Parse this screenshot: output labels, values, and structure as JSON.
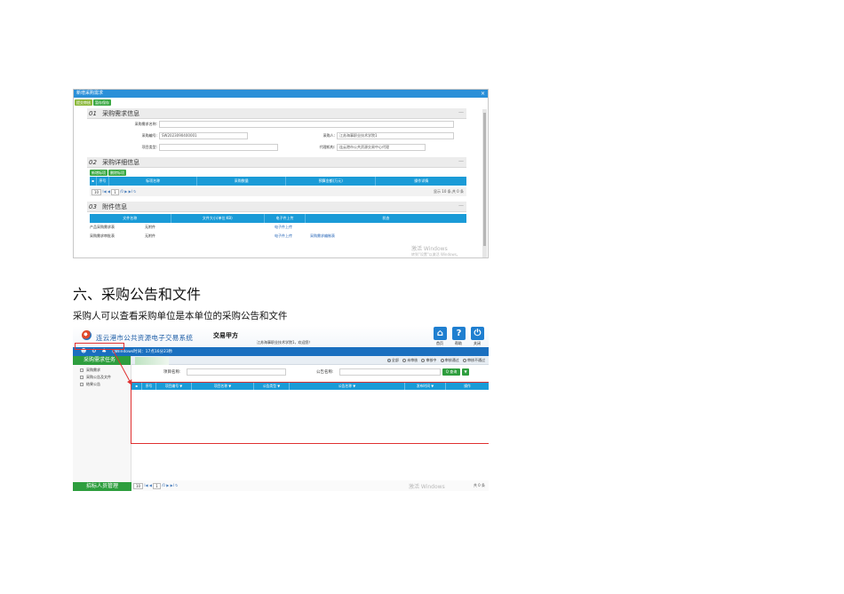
{
  "screenshot1": {
    "window_title": "新增采购需求",
    "toolbar": {
      "submit_label": "提交审核",
      "save_label": "暂存保存"
    },
    "section1": {
      "num": "01",
      "title": "采购需求信息"
    },
    "form": {
      "demand_name_label": "采购需求名称:",
      "demand_code_label": "采购编号:",
      "demand_code_value": "SW2023090400001",
      "purchaser_label": "采购人:",
      "purchaser_value": "江苏海事职业技术学院1",
      "project_type_label": "项目类型:",
      "agency_label": "代理机构:",
      "agency_value": "连云港市公共资源交易中心代理"
    },
    "section2": {
      "num": "02",
      "title": "采购详细信息"
    },
    "grid_tools": {
      "add_label": "新增标项",
      "delete_label": "删除标项"
    },
    "grid_columns": [
      "序号",
      "标项名称",
      "采购数量",
      "预算金额(万元)",
      "操作详情"
    ],
    "pager1": {
      "page_size": "10",
      "page": "1",
      "of": "/0",
      "info": "显示 10 条,共 0 条"
    },
    "section3": {
      "num": "03",
      "title": "附件信息"
    },
    "att_columns": [
      "文件名称",
      "文件大小(单位:KB)",
      "电子件上传",
      "状态"
    ],
    "att_rows": [
      {
        "name": "产品采购需求表",
        "size": "无附件",
        "upload": "电子件上传",
        "status": ""
      },
      {
        "name": "采购需求审批表",
        "size": "无附件",
        "upload": "电子件上传",
        "status": "采购需求编制表"
      }
    ],
    "watermark_title": "激活 Windows",
    "watermark_sub": "转到\"设置\"以激活 Windows。",
    "more_glyph": "—",
    "close_glyph": "×"
  },
  "heading": "六、采购公告和文件",
  "paragraph": "采购人可以查看采购单位是本单位的采购公告和文件",
  "screenshot2": {
    "system_title": "连云港市公共资源电子交易系统",
    "role_title": "交易甲方",
    "welcome": "江苏海事职业技术学院1，欢迎您！",
    "header_buttons": [
      {
        "label": "首页",
        "glyph": "⌂"
      },
      {
        "label": "帮助",
        "glyph": "?"
      },
      {
        "label": "关闭",
        "glyph": "⏻"
      }
    ],
    "bluebar_icons": "☻ ⚙ ♣ ◎",
    "bluebar_text": "Windows时间：17点16分23秒",
    "sidebar_title": "采购需求任务",
    "sidebar_items": [
      "采购需求",
      "采购公告及文件",
      "结果公告"
    ],
    "sidebar_footer": "招标人员管理",
    "radios": [
      "全部",
      "未审核",
      "审核中",
      "审核通过",
      "审核不通过"
    ],
    "search": {
      "project_label": "项目名称:",
      "notice_label": "公告名称:",
      "search_button": "Q 查询",
      "more_button": "▼"
    },
    "list_columns": [
      "序号",
      "项目编号 ▼",
      "项目名称 ▼",
      "公告类型 ▼",
      "公告名称 ▼",
      "发布时间 ▼",
      "操作"
    ],
    "pager": {
      "page_size": "10",
      "page": "1",
      "of": "/0",
      "info": "共 0 条"
    },
    "watermark": "激活 Windows"
  }
}
